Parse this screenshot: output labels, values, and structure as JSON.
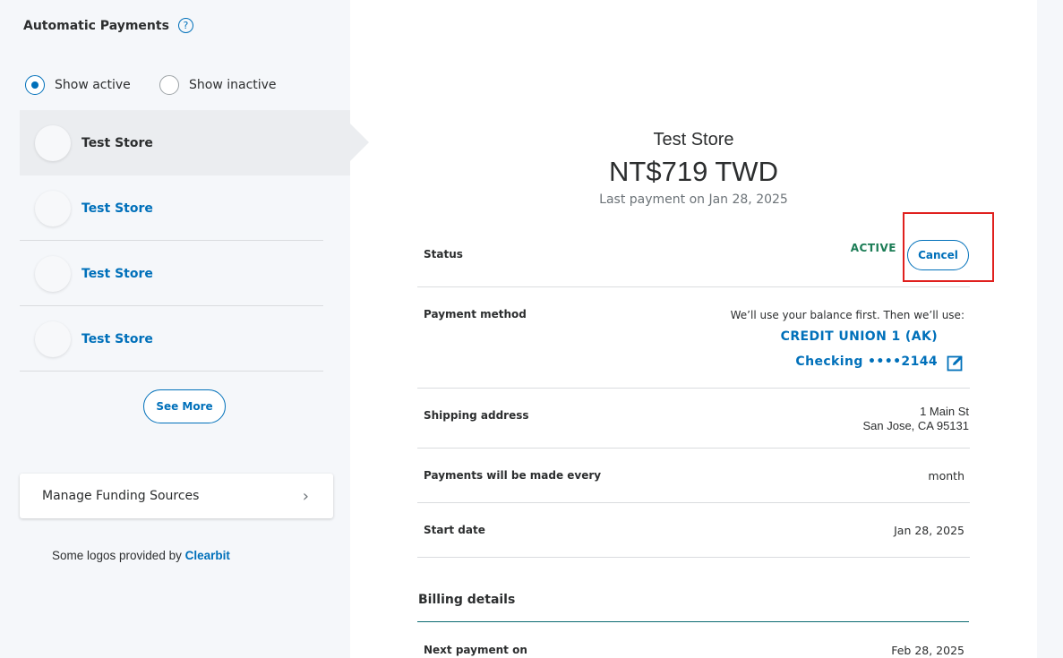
{
  "sidebar": {
    "title": "Automatic Payments",
    "help_icon": "?",
    "filters": [
      {
        "label": "Show active",
        "checked": true
      },
      {
        "label": "Show inactive",
        "checked": false
      }
    ],
    "stores": [
      {
        "name": "Test Store",
        "selected": true
      },
      {
        "name": "Test Store",
        "selected": false
      },
      {
        "name": "Test Store",
        "selected": false
      },
      {
        "name": "Test Store",
        "selected": false
      }
    ],
    "see_more_label": "See More",
    "manage_funding_label": "Manage Funding Sources",
    "chevron": "›",
    "credits_text": "Some logos provided by ",
    "credits_link": "Clearbit"
  },
  "detail": {
    "store_name": "Test Store",
    "amount": "NT$719 TWD",
    "last_payment": "Last payment on Jan 28, 2025",
    "status_label": "Status",
    "status_value": "ACTIVE",
    "cancel_label": "Cancel",
    "payment_method_label": "Payment method",
    "payment_note": "We’ll use your balance first. Then we’ll use:",
    "bank_name": "CREDIT UNION 1 (AK)",
    "account": "Checking ••••2144",
    "shipping_label": "Shipping address",
    "address_line1": "1 Main St",
    "address_line2": "San Jose, CA 95131",
    "frequency_label": "Payments will be made every",
    "frequency_value": "month",
    "start_label": "Start date",
    "start_value": "Jan 28, 2025",
    "billing_title": "Billing details",
    "next_payment_label": "Next payment on",
    "next_payment_value": "Feb 28, 2025"
  },
  "colors": {
    "accent": "#0070ba",
    "active": "#1b7c55",
    "highlight": "#e0201e"
  },
  "icons": [
    "help-icon",
    "chevron-right-icon",
    "edit-icon"
  ]
}
